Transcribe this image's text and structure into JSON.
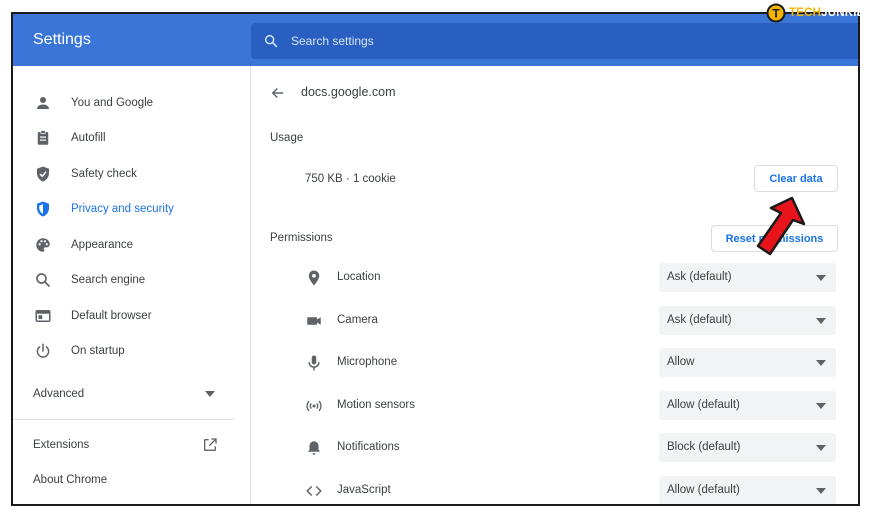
{
  "app": {
    "title": "Settings"
  },
  "search": {
    "placeholder": "Search settings"
  },
  "sidebar": {
    "items": [
      {
        "label": "You and Google",
        "icon": "person-icon"
      },
      {
        "label": "Autofill",
        "icon": "clipboard-icon"
      },
      {
        "label": "Safety check",
        "icon": "shield-check-icon"
      },
      {
        "label": "Privacy and security",
        "icon": "shield-icon",
        "active": true
      },
      {
        "label": "Appearance",
        "icon": "palette-icon"
      },
      {
        "label": "Search engine",
        "icon": "search-icon"
      },
      {
        "label": "Default browser",
        "icon": "browser-window-icon"
      },
      {
        "label": "On startup",
        "icon": "power-icon"
      }
    ],
    "advanced_label": "Advanced",
    "extensions_label": "Extensions",
    "about_label": "About Chrome"
  },
  "site": {
    "name": "docs.google.com"
  },
  "usage": {
    "heading": "Usage",
    "value": "750 KB · 1 cookie",
    "clear_button": "Clear data"
  },
  "permissions": {
    "heading": "Permissions",
    "reset_button": "Reset permissions",
    "items": [
      {
        "label": "Location",
        "value": "Ask (default)",
        "icon": "location-pin-icon"
      },
      {
        "label": "Camera",
        "value": "Ask (default)",
        "icon": "camera-icon"
      },
      {
        "label": "Microphone",
        "value": "Allow",
        "icon": "microphone-icon"
      },
      {
        "label": "Motion sensors",
        "value": "Allow (default)",
        "icon": "motion-sensor-icon"
      },
      {
        "label": "Notifications",
        "value": "Block (default)",
        "icon": "bell-icon"
      },
      {
        "label": "JavaScript",
        "value": "Allow (default)",
        "icon": "code-icon"
      }
    ]
  },
  "watermark": {
    "prefix": "TECH",
    "suffix": "JUNKIE",
    "letter": "T"
  },
  "colors": {
    "header": "#3a76d8",
    "search_bg": "#2a5fc2",
    "accent": "#1a73e8",
    "annotation_arrow": "#e8141c"
  }
}
